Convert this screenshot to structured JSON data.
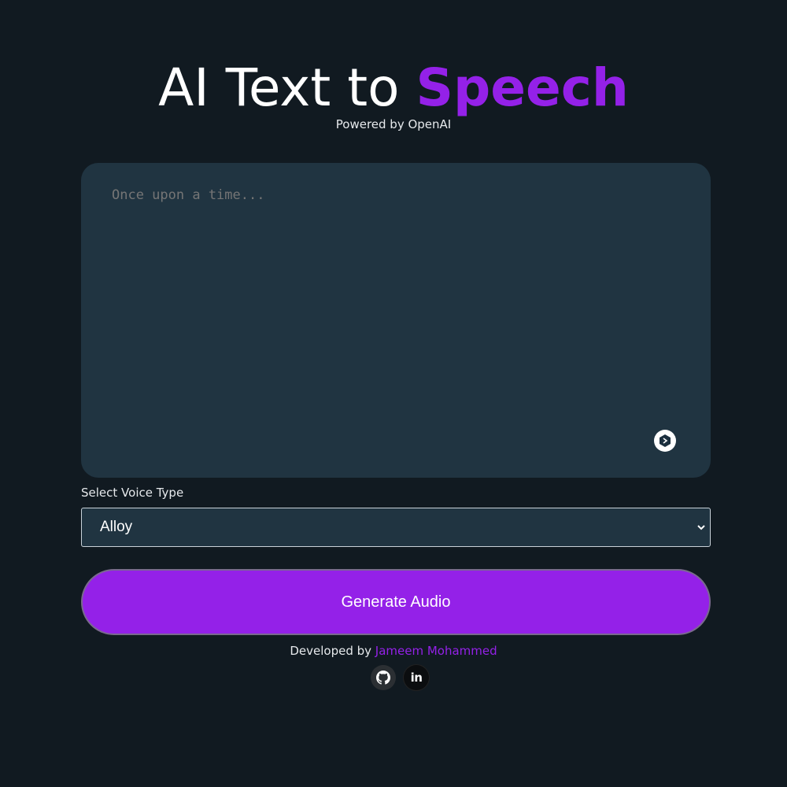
{
  "header": {
    "title_main": "AI Text to ",
    "title_accent": "Speech",
    "subtitle": "Powered by OpenAI"
  },
  "text_input": {
    "placeholder": "Once upon a time...",
    "value": ""
  },
  "voice": {
    "label": "Select Voice Type",
    "selected": "Alloy"
  },
  "generate_button": {
    "label": "Generate Audio"
  },
  "footer": {
    "developed_by": "Developed by ",
    "author": "Jameem Mohammed",
    "linkedin_glyph": "in"
  },
  "colors": {
    "background": "#111a21",
    "panel": "#203441",
    "accent": "#9421e8"
  },
  "icons": [
    "grammarly-icon",
    "chevron-down-icon",
    "github-icon",
    "linkedin-icon"
  ]
}
